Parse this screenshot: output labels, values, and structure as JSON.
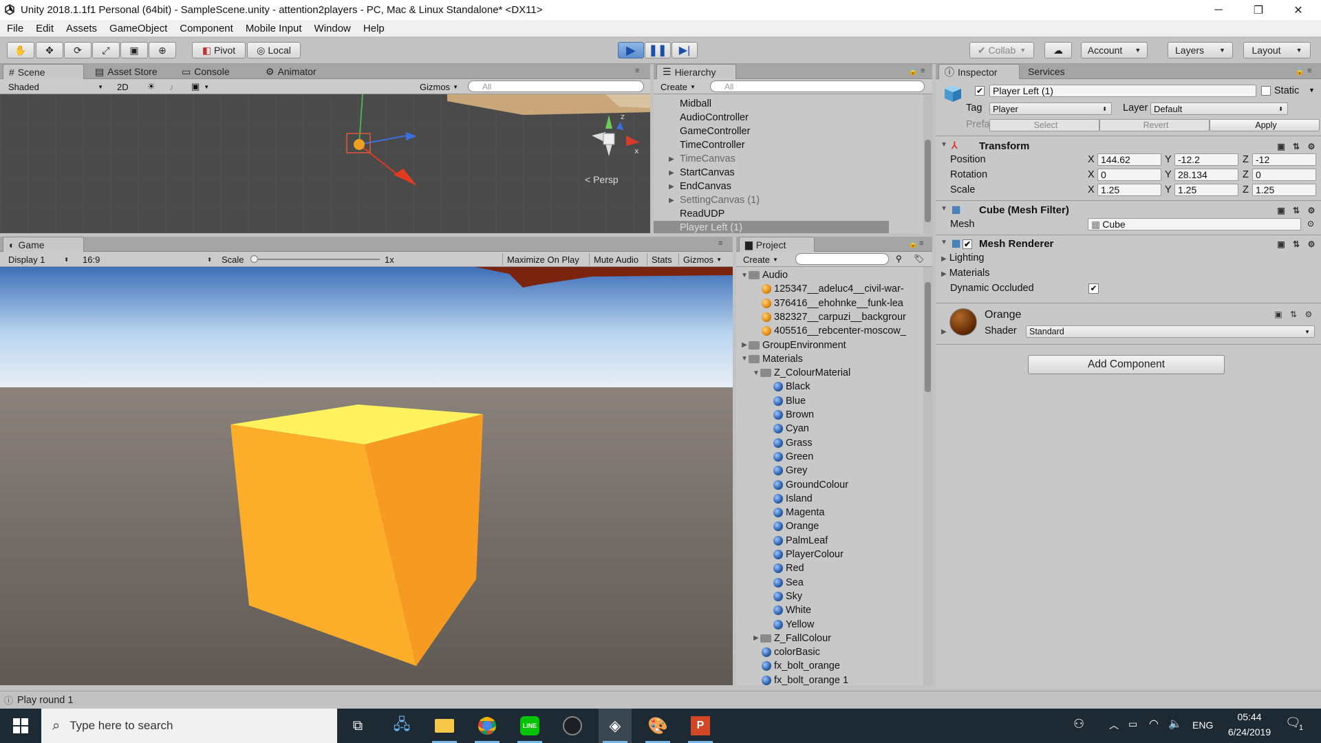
{
  "window": {
    "title": "Unity 2018.1.1f1 Personal (64bit) - SampleScene.unity - attention2players - PC, Mac & Linux Standalone* <DX11>",
    "controls": [
      "─",
      "❐",
      "✕"
    ]
  },
  "menu": [
    "File",
    "Edit",
    "Assets",
    "GameObject",
    "Component",
    "Mobile Input",
    "Window",
    "Help"
  ],
  "toolbar": {
    "pivot": "Pivot",
    "local": "Local",
    "collab": "Collab",
    "account": "Account",
    "layers": "Layers",
    "layout": "Layout"
  },
  "scene": {
    "tabs": [
      "Scene",
      "Asset Store",
      "Console",
      "Animator"
    ],
    "shading": "Shaded",
    "mode2d": "2D",
    "gizmos": "Gizmos",
    "search_placeholder": "All",
    "persp": "Persp",
    "axis_x": "x",
    "axis_z": "z"
  },
  "game": {
    "tab": "Game",
    "display": "Display 1",
    "aspect": "16:9",
    "scale_label": "Scale",
    "scale_value": "1x",
    "buttons": [
      "Maximize On Play",
      "Mute Audio",
      "Stats",
      "Gizmos"
    ]
  },
  "hierarchy": {
    "tab": "Hierarchy",
    "create": "Create",
    "search_placeholder": "All",
    "items": [
      {
        "label": "Midball",
        "arrow": false,
        "dim": false
      },
      {
        "label": "AudioController",
        "arrow": false,
        "dim": false
      },
      {
        "label": "GameController",
        "arrow": false,
        "dim": false
      },
      {
        "label": "TimeController",
        "arrow": false,
        "dim": false
      },
      {
        "label": "TimeCanvas",
        "arrow": true,
        "dim": true
      },
      {
        "label": "StartCanvas",
        "arrow": true,
        "dim": false
      },
      {
        "label": "EndCanvas",
        "arrow": true,
        "dim": false
      },
      {
        "label": "SettingCanvas (1)",
        "arrow": true,
        "dim": true
      },
      {
        "label": "ReadUDP",
        "arrow": false,
        "dim": false
      },
      {
        "label": "Player Left (1)",
        "arrow": false,
        "dim": false,
        "selected": true
      }
    ]
  },
  "project": {
    "tab": "Project",
    "create": "Create",
    "items": [
      {
        "label": "Audio",
        "type": "folder",
        "indent": 0,
        "arrow": "▼"
      },
      {
        "label": "125347__adeluc4__civil-war-",
        "type": "audio",
        "indent": 1
      },
      {
        "label": "376416__ehohnke__funk-lea",
        "type": "audio",
        "indent": 1
      },
      {
        "label": "382327__carpuzi__backgrour",
        "type": "audio",
        "indent": 1
      },
      {
        "label": "405516__rebcenter-moscow_",
        "type": "audio",
        "indent": 1
      },
      {
        "label": "GroupEnvironment",
        "type": "folder",
        "indent": 0,
        "arrow": "▶"
      },
      {
        "label": "Materials",
        "type": "folder",
        "indent": 0,
        "arrow": "▼"
      },
      {
        "label": "Z_ColourMaterial",
        "type": "folder",
        "indent": 1,
        "arrow": "▼"
      },
      {
        "label": "Black",
        "type": "mat",
        "indent": 2
      },
      {
        "label": "Blue",
        "type": "mat",
        "indent": 2
      },
      {
        "label": "Brown",
        "type": "mat",
        "indent": 2
      },
      {
        "label": "Cyan",
        "type": "mat",
        "indent": 2
      },
      {
        "label": "Grass",
        "type": "mat",
        "indent": 2
      },
      {
        "label": "Green",
        "type": "mat",
        "indent": 2
      },
      {
        "label": "Grey",
        "type": "mat",
        "indent": 2
      },
      {
        "label": "GroundColour",
        "type": "mat",
        "indent": 2
      },
      {
        "label": "Island",
        "type": "mat",
        "indent": 2
      },
      {
        "label": "Magenta",
        "type": "mat",
        "indent": 2
      },
      {
        "label": "Orange",
        "type": "mat",
        "indent": 2
      },
      {
        "label": "PalmLeaf",
        "type": "mat",
        "indent": 2
      },
      {
        "label": "PlayerColour",
        "type": "mat",
        "indent": 2
      },
      {
        "label": "Red",
        "type": "mat",
        "indent": 2
      },
      {
        "label": "Sea",
        "type": "mat",
        "indent": 2
      },
      {
        "label": "Sky",
        "type": "mat",
        "indent": 2
      },
      {
        "label": "White",
        "type": "mat",
        "indent": 2
      },
      {
        "label": "Yellow",
        "type": "mat",
        "indent": 2
      },
      {
        "label": "Z_FallColour",
        "type": "folder",
        "indent": 1,
        "arrow": "▶"
      },
      {
        "label": "colorBasic",
        "type": "mat",
        "indent": 1
      },
      {
        "label": "fx_bolt_orange",
        "type": "mat",
        "indent": 1
      },
      {
        "label": "fx_bolt_orange 1",
        "type": "mat",
        "indent": 1
      }
    ]
  },
  "inspector": {
    "tabs": [
      "Inspector",
      "Services"
    ],
    "object_name": "Player Left (1)",
    "static_label": "Static",
    "tag_label": "Tag",
    "tag_value": "Player",
    "layer_label": "Layer",
    "layer_value": "Default",
    "prefab_label": "Prefab",
    "prefab_buttons": [
      "Select",
      "Revert",
      "Apply"
    ],
    "transform": {
      "title": "Transform",
      "position_label": "Position",
      "rotation_label": "Rotation",
      "scale_label": "Scale",
      "position": [
        "144.62",
        "-12.2",
        "-12"
      ],
      "rotation": [
        "0",
        "28.134",
        "0"
      ],
      "scale": [
        "1.25",
        "1.25",
        "1.25"
      ],
      "axes": [
        "X",
        "Y",
        "Z"
      ]
    },
    "mesh_filter": {
      "title": "Cube (Mesh Filter)",
      "mesh_label": "Mesh",
      "mesh_value": "Cube"
    },
    "mesh_renderer": {
      "title": "Mesh Renderer",
      "lighting": "Lighting",
      "materials": "Materials",
      "dynamic_occluded": "Dynamic Occluded"
    },
    "material": {
      "name": "Orange",
      "shader_label": "Shader",
      "shader_value": "Standard"
    },
    "add_component": "Add Component"
  },
  "status": {
    "message": "Play round 1"
  },
  "taskbar": {
    "search_placeholder": "Type here to search",
    "language": "ENG",
    "time": "05:44",
    "date": "6/24/2019",
    "notification_count": "1"
  }
}
